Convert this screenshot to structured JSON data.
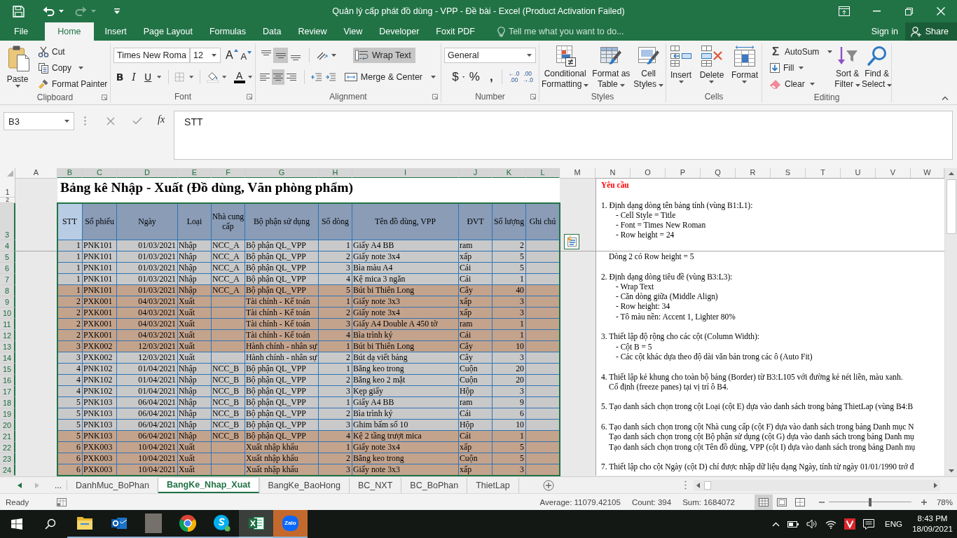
{
  "title_bar": {
    "title": "Quản lý cấp phát đồ dùng - VPP - Đề bài - Excel (Product Activation Failed)",
    "redo_disabled": true
  },
  "ribbon": {
    "tabs": [
      {
        "label": "File",
        "selected": false
      },
      {
        "label": "Home",
        "selected": true
      },
      {
        "label": "Insert",
        "selected": false
      },
      {
        "label": "Page Layout",
        "selected": false
      },
      {
        "label": "Formulas",
        "selected": false
      },
      {
        "label": "Data",
        "selected": false
      },
      {
        "label": "Review",
        "selected": false
      },
      {
        "label": "View",
        "selected": false
      },
      {
        "label": "Developer",
        "selected": false
      },
      {
        "label": "Foxit PDF",
        "selected": false
      }
    ],
    "tell_me": {
      "placeholder": "Tell me what you want to do..."
    },
    "sign_in": "Sign in",
    "share": "Share",
    "clipboard": {
      "label": "Clipboard",
      "launcher": true,
      "paste": "Paste",
      "cut": "Cut",
      "copy": "Copy",
      "format_painter": "Format Painter"
    },
    "font": {
      "label": "Font",
      "launcher": true,
      "font_name": "Times New Roma",
      "font_size": "12",
      "grow": "A",
      "shrink": "A",
      "bold": "B",
      "italic": "I",
      "underline": "U",
      "font_color": "A"
    },
    "alignment": {
      "label": "Alignment",
      "launcher": true,
      "vertical_align": [
        {
          "selected": false
        },
        {
          "selected": true
        },
        {
          "selected": false
        }
      ],
      "horizontal_align": [
        {
          "selected": false
        },
        {
          "selected": true
        },
        {
          "selected": false
        }
      ],
      "wrap_text": {
        "label": "Wrap Text",
        "on": true
      },
      "merge": "Merge & Center"
    },
    "number": {
      "label": "Number",
      "launcher": true,
      "format": "General",
      "currency": "$",
      "percent": "%",
      "comma": ",",
      "increase_decimal": [
        "←.0",
        ".00"
      ],
      "decrease_decimal": [
        ".00",
        "→.0"
      ]
    },
    "styles": {
      "label": "Styles",
      "buttons": [
        {
          "lines": [
            "Conditional",
            "Formatting"
          ]
        },
        {
          "lines": [
            "Format as",
            "Table"
          ]
        },
        {
          "lines": [
            "Cell",
            "Styles"
          ]
        }
      ]
    },
    "cells": {
      "label": "Cells",
      "buttons": [
        "Insert",
        "Delete",
        "Format"
      ]
    },
    "editing": {
      "label": "Editing",
      "sigma": "Σ",
      "autosum": "AutoSum",
      "fill": "Fill",
      "clear": "Clear",
      "buttons": [
        {
          "lines": [
            "Sort &",
            "Filter"
          ]
        },
        {
          "lines": [
            "Find &",
            "Select"
          ]
        }
      ]
    }
  },
  "formula_bar": {
    "name_box": "B3",
    "fx": "fx",
    "formula": "STT"
  },
  "sheet": {
    "column_headers": [
      {
        "label": "A",
        "selected": false
      },
      {
        "label": "B",
        "selected": true
      },
      {
        "label": "C",
        "selected": true
      },
      {
        "label": "D",
        "selected": true
      },
      {
        "label": "E",
        "selected": true
      },
      {
        "label": "F",
        "selected": true
      },
      {
        "label": "G",
        "selected": true
      },
      {
        "label": "H",
        "selected": true
      },
      {
        "label": "I",
        "selected": true
      },
      {
        "label": "J",
        "selected": true
      },
      {
        "label": "K",
        "selected": true
      },
      {
        "label": "L",
        "selected": true
      },
      {
        "label": "M",
        "selected": false
      },
      {
        "label": "N",
        "selected": false
      },
      {
        "label": "O",
        "selected": false
      },
      {
        "label": "P",
        "selected": false
      },
      {
        "label": "Q",
        "selected": false
      },
      {
        "label": "R",
        "selected": false
      },
      {
        "label": "S",
        "selected": false
      },
      {
        "label": "T",
        "selected": false
      },
      {
        "label": "U",
        "selected": false
      },
      {
        "label": "V",
        "selected": false
      },
      {
        "label": "W",
        "selected": false
      }
    ],
    "row_headers": [
      {
        "label": "1",
        "selected": false
      },
      {
        "label": "2",
        "selected": false
      },
      {
        "label": "3",
        "selected": true
      },
      {
        "label": "4",
        "selected": true
      },
      {
        "label": "5",
        "selected": true
      },
      {
        "label": "6",
        "selected": true
      },
      {
        "label": "7",
        "selected": true
      },
      {
        "label": "8",
        "selected": true
      },
      {
        "label": "9",
        "selected": true
      },
      {
        "label": "10",
        "selected": true
      },
      {
        "label": "11",
        "selected": true
      },
      {
        "label": "12",
        "selected": true
      },
      {
        "label": "13",
        "selected": true
      },
      {
        "label": "14",
        "selected": true
      },
      {
        "label": "15",
        "selected": true
      },
      {
        "label": "16",
        "selected": true
      },
      {
        "label": "17",
        "selected": true
      },
      {
        "label": "18",
        "selected": true
      },
      {
        "label": "19",
        "selected": true
      },
      {
        "label": "20",
        "selected": true
      },
      {
        "label": "21",
        "selected": true
      },
      {
        "label": "22",
        "selected": true
      },
      {
        "label": "23",
        "selected": true
      },
      {
        "label": "24",
        "selected": true
      }
    ],
    "title": "Bảng kê Nhập - Xuất (Đồ dùng, Văn phòng phẩm)",
    "table": {
      "columns": [
        {
          "label": "STT",
          "active": true
        },
        {
          "label": "Số phiếu",
          "active": false
        },
        {
          "label": "Ngày",
          "active": false
        },
        {
          "label": "Loại",
          "active": false
        },
        {
          "label": "Nhà cung cấp",
          "active": false
        },
        {
          "label": "Bộ phận sử dụng",
          "active": false
        },
        {
          "label": "Số dòng",
          "active": false
        },
        {
          "label": "Tên đồ dùng, VPP",
          "active": false
        },
        {
          "label": "ĐVT",
          "active": false
        },
        {
          "label": "Số lượng",
          "active": false
        },
        {
          "label": "Ghi chú",
          "active": false
        }
      ],
      "rows": [
        {
          "stt": "1",
          "so_phieu": "PNK101",
          "ngay": "01/03/2021",
          "loai": "Nhập",
          "ncc": "NCC_A",
          "bo_phan": "Bộ phận QL_VPP",
          "so_dong": "1",
          "ten": "Giấy A4 BB",
          "dvt": "ram",
          "so_luong": "2",
          "color": "#c9c9c9"
        },
        {
          "stt": "1",
          "so_phieu": "PNK101",
          "ngay": "01/03/2021",
          "loai": "Nhập",
          "ncc": "NCC_A",
          "bo_phan": "Bộ phận QL_VPP",
          "so_dong": "2",
          "ten": "Giấy note 3x4",
          "dvt": "xấp",
          "so_luong": "5",
          "color": "#c9c9c9"
        },
        {
          "stt": "1",
          "so_phieu": "PNK101",
          "ngay": "01/03/2021",
          "loai": "Nhập",
          "ncc": "NCC_A",
          "bo_phan": "Bộ phận QL_VPP",
          "so_dong": "3",
          "ten": "Bìa màu A4",
          "dvt": "Cái",
          "so_luong": "5",
          "color": "#c9c9c9"
        },
        {
          "stt": "1",
          "so_phieu": "PNK101",
          "ngay": "01/03/2021",
          "loai": "Nhập",
          "ncc": "NCC_A",
          "bo_phan": "Bộ phận QL_VPP",
          "so_dong": "4",
          "ten": "Kệ mica 3 ngăn",
          "dvt": "Cái",
          "so_luong": "1",
          "color": "#c9c9c9"
        },
        {
          "stt": "1",
          "so_phieu": "PNK101",
          "ngay": "01/03/2021",
          "loai": "Nhập",
          "ncc": "NCC_A",
          "bo_phan": "Bộ phận QL_VPP",
          "so_dong": "5",
          "ten": "Bút bi Thiên Long",
          "dvt": "Cây",
          "so_luong": "40",
          "color": "#c4a38c"
        },
        {
          "stt": "2",
          "so_phieu": "PXK001",
          "ngay": "04/03/2021",
          "loai": "Xuất",
          "bo_phan": "Tài chính - Kế toán",
          "so_dong": "1",
          "ten": "Giấy note 3x3",
          "dvt": "xấp",
          "so_luong": "3",
          "color": "#c4a38c"
        },
        {
          "stt": "2",
          "so_phieu": "PXK001",
          "ngay": "04/03/2021",
          "loai": "Xuất",
          "bo_phan": "Tài chính - Kế toán",
          "so_dong": "2",
          "ten": "Giấy note 3x4",
          "dvt": "xấp",
          "so_luong": "3",
          "color": "#c4a38c"
        },
        {
          "stt": "2",
          "so_phieu": "PXK001",
          "ngay": "04/03/2021",
          "loai": "Xuất",
          "bo_phan": "Tài chính - Kế toán",
          "so_dong": "3",
          "ten": "Giấy A4 Double A 450 tờ",
          "dvt": "ram",
          "so_luong": "1",
          "color": "#c4a38c"
        },
        {
          "stt": "2",
          "so_phieu": "PXK001",
          "ngay": "04/03/2021",
          "loai": "Xuất",
          "bo_phan": "Tài chính - Kế toán",
          "so_dong": "4",
          "ten": "Bìa trình ký",
          "dvt": "Cái",
          "so_luong": "1",
          "color": "#c4a38c"
        },
        {
          "stt": "3",
          "so_phieu": "PXK002",
          "ngay": "12/03/2021",
          "loai": "Xuất",
          "bo_phan": "Hành chính - nhân sự",
          "so_dong": "1",
          "ten": "Bút bi Thiên Long",
          "dvt": "Cây",
          "so_luong": "10",
          "color": "#c4a38c"
        },
        {
          "stt": "3",
          "so_phieu": "PXK002",
          "ngay": "12/03/2021",
          "loai": "Xuất",
          "bo_phan": "Hành chính - nhân sự",
          "so_dong": "2",
          "ten": "Bút dạ viết bảng",
          "dvt": "Cây",
          "so_luong": "3",
          "color": "#c9c9c9"
        },
        {
          "stt": "4",
          "so_phieu": "PNK102",
          "ngay": "01/04/2021",
          "loai": "Nhập",
          "ncc": "NCC_B",
          "bo_phan": "Bộ phận QL_VPP",
          "so_dong": "1",
          "ten": "Băng keo trong",
          "dvt": "Cuộn",
          "so_luong": "20",
          "color": "#c9c9c9"
        },
        {
          "stt": "4",
          "so_phieu": "PNK102",
          "ngay": "01/04/2021",
          "loai": "Nhập",
          "ncc": "NCC_B",
          "bo_phan": "Bộ phận QL_VPP",
          "so_dong": "2",
          "ten": "Băng keo 2 mặt",
          "dvt": "Cuộn",
          "so_luong": "20",
          "color": "#c9c9c9"
        },
        {
          "stt": "4",
          "so_phieu": "PNK102",
          "ngay": "01/04/2021",
          "loai": "Nhập",
          "ncc": "NCC_B",
          "bo_phan": "Bộ phận QL_VPP",
          "so_dong": "3",
          "ten": "Kẹp giấy",
          "dvt": "Hộp",
          "so_luong": "3",
          "color": "#c9c9c9"
        },
        {
          "stt": "5",
          "so_phieu": "PNK103",
          "ngay": "06/04/2021",
          "loai": "Nhập",
          "ncc": "NCC_B",
          "bo_phan": "Bộ phận QL_VPP",
          "so_dong": "1",
          "ten": "Giấy A4 BB",
          "dvt": "ram",
          "so_luong": "9",
          "color": "#c9c9c9"
        },
        {
          "stt": "5",
          "so_phieu": "PNK103",
          "ngay": "06/04/2021",
          "loai": "Nhập",
          "ncc": "NCC_B",
          "bo_phan": "Bộ phận QL_VPP",
          "so_dong": "2",
          "ten": "Bìa trình ký",
          "dvt": "Cái",
          "so_luong": "6",
          "color": "#c9c9c9"
        },
        {
          "stt": "5",
          "so_phieu": "PNK103",
          "ngay": "06/04/2021",
          "loai": "Nhập",
          "ncc": "NCC_B",
          "bo_phan": "Bộ phận QL_VPP",
          "so_dong": "3",
          "ten": "Ghim bấm số 10",
          "dvt": "Hộp",
          "so_luong": "10",
          "color": "#c9c9c9"
        },
        {
          "stt": "5",
          "so_phieu": "PNK103",
          "ngay": "06/04/2021",
          "loai": "Nhập",
          "ncc": "NCC_B",
          "bo_phan": "Bộ phận QL_VPP",
          "so_dong": "4",
          "ten": "Kệ 2 tầng trượt mica",
          "dvt": "Cái",
          "so_luong": "1",
          "color": "#c4a38c"
        },
        {
          "stt": "6",
          "so_phieu": "PXK003",
          "ngay": "10/04/2021",
          "loai": "Xuất",
          "bo_phan": "Xuất nhập khẩu",
          "so_dong": "1",
          "ten": "Giấy note 3x4",
          "dvt": "xấp",
          "so_luong": "5",
          "color": "#c4a38c"
        },
        {
          "stt": "6",
          "so_phieu": "PXK003",
          "ngay": "10/04/2021",
          "loai": "Xuất",
          "bo_phan": "Xuất nhập khẩu",
          "so_dong": "2",
          "ten": "Băng keo trong",
          "dvt": "Cuộn",
          "so_luong": "5",
          "color": "#c4a38c"
        },
        {
          "stt": "6",
          "so_phieu": "PXK003",
          "ngay": "10/04/2021",
          "loai": "Xuất",
          "bo_phan": "Xuất nhập khẩu",
          "so_dong": "3",
          "ten": "Giấy note 3x3",
          "dvt": "xấp",
          "so_luong": "3",
          "color": "#c4a38c"
        }
      ]
    },
    "requirements": {
      "top_pane": [
        {
          "kind": "heading",
          "text": "Yêu cầu"
        },
        {
          "kind": "item",
          "text": "1. Định dạng dòng tên bảng tính (vùng B1:L1):",
          "gap_before": true
        },
        {
          "kind": "sub",
          "text": "- Cell Style = Title"
        },
        {
          "kind": "sub",
          "text": "- Font = Times New Roman"
        },
        {
          "kind": "sub",
          "text": "- Row height = 24"
        }
      ],
      "bottom_pane": [
        {
          "kind": "cont",
          "text": "Dòng 2 có Row height = 5"
        },
        {
          "kind": "item",
          "text": "2. Định dạng dòng tiêu đề (vùng B3:L3):",
          "gap_before": true
        },
        {
          "kind": "sub",
          "text": "- Wrap Text"
        },
        {
          "kind": "sub",
          "text": "- Căn dòng giữa (Middle Align)"
        },
        {
          "kind": "sub",
          "text": "- Row height: 34"
        },
        {
          "kind": "sub",
          "text": "- Tô màu nền: Accent 1, Lighter 80%"
        },
        {
          "kind": "item",
          "text": "3. Thiết lập độ rộng cho các cột (Column Width):",
          "gap_before": true
        },
        {
          "kind": "sub",
          "text": "- Cột B = 5"
        },
        {
          "kind": "sub",
          "text": "- Các cột khác dựa theo độ dài văn bản trong các ô (Auto Fit)"
        },
        {
          "kind": "item",
          "text": "4. Thiết lập kẻ khung cho toàn bộ bảng (Border) từ B3:L105 với đường kẻ nét liền, màu xanh.",
          "gap_before": true
        },
        {
          "kind": "cont",
          "text": "Cố định (freeze panes) tại vị trí ô B4."
        },
        {
          "kind": "item",
          "text": "5. Tạo danh sách chọn trong cột Loại (cột E) dựa vào danh sách trong bảng ThietLap (vùng B4:B",
          "gap_before": true
        },
        {
          "kind": "item",
          "text": "6. Tạo danh sách chọn trong cột Nhà cung cấp (cột F) dựa vào danh sách trong bảng Danh mục N",
          "gap_before": true
        },
        {
          "kind": "cont",
          "text": "Tạo danh sách chọn trong cột Bộ phận sử dụng (cột G) dựa vào danh sách trong bảng Danh mụ"
        },
        {
          "kind": "cont",
          "text": "Tạo danh sách chọn trong cột Tên đồ dùng, VPP (cột I) dựa vào danh sách trong bảng Danh mụ"
        },
        {
          "kind": "item",
          "text": "7. Thiết lập cho cột Ngày (cột D) chỉ được nhập dữ liệu dạng Ngày, tính từ ngày 01/01/1990 trở đ",
          "gap_before": true
        }
      ]
    }
  },
  "sheet_tabs": {
    "more": "...",
    "tabs": [
      {
        "label": "DanhMuc_BoPhan",
        "selected": false
      },
      {
        "label": "BangKe_Nhap_Xuat",
        "selected": true
      },
      {
        "label": "BangKe_BaoHong",
        "selected": false
      },
      {
        "label": "BC_NXT",
        "selected": false
      },
      {
        "label": "BC_BoPhan",
        "selected": false
      },
      {
        "label": "ThietLap",
        "selected": false
      }
    ]
  },
  "status_bar": {
    "mode": "Ready",
    "average": "Average: 11079.42105",
    "count": "Count: 394",
    "sum": "Sum: 1684072",
    "views": [
      {
        "selected": true
      },
      {
        "selected": false
      },
      {
        "selected": false
      }
    ],
    "zoom_slider": {
      "level": 0.5
    },
    "zoom": "78%"
  },
  "taskbar": {
    "apps": [
      {
        "running": true,
        "active": false,
        "flashing": false
      },
      {
        "running": true,
        "active": false,
        "flashing": false
      },
      {
        "running": true,
        "active": false,
        "flashing": false
      },
      {
        "running": true,
        "active": false,
        "flashing": false
      },
      {
        "running": true,
        "active": false,
        "flashing": false
      },
      {
        "running": true,
        "active": true,
        "flashing": false
      },
      {
        "running": true,
        "active": false,
        "flashing": true
      }
    ],
    "logo_text": "Zalo",
    "language": "ENG",
    "time": "8:43 PM",
    "date": "18/09/2021"
  }
}
